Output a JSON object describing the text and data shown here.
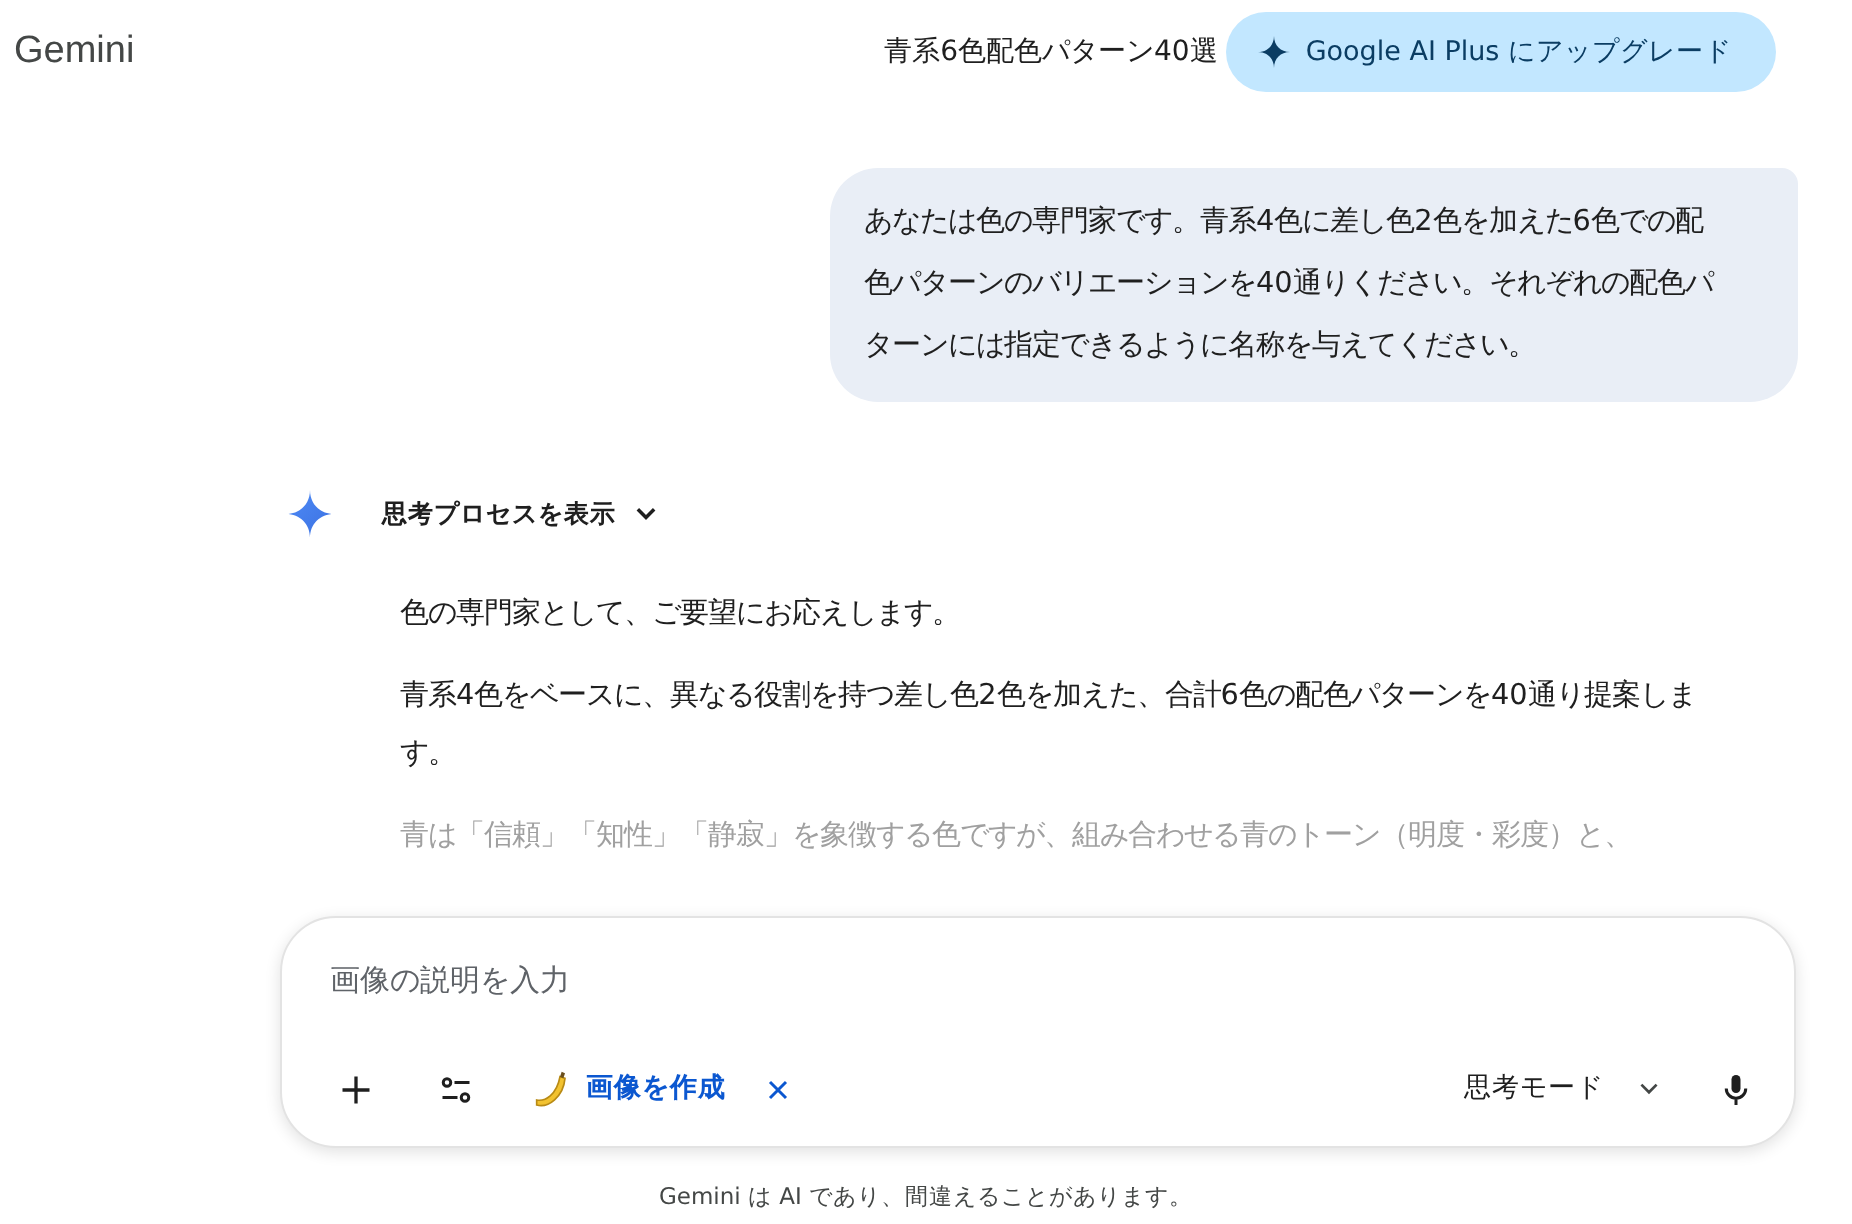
{
  "app_title": "Gemini",
  "conversation_title": "青系6色配色パターン40選",
  "upgrade_button": "Google AI Plus にアップグレード",
  "user_message": "あなたは色の専門家です。青系4色に差し色2色を加えた6色での配色パターンのバリエーションを40通りください。それぞれの配色パターンには指定できるように名称を与えてください。",
  "thinking_toggle": {
    "label": "思考プロセスを表示",
    "expanded": false
  },
  "response_paragraphs": [
    {
      "text": "色の専門家として、ご要望にお応えします。",
      "faded": false
    },
    {
      "text": "青系4色をベースに、異なる役割を持つ差し色2色を加えた、合計6色の配色パターンを40通り提案します。",
      "faded": false
    },
    {
      "text": "青は「信頼」「知性」「静寂」を象徴する色ですが、組み合わせる青のトーン（明度・彩度）と、",
      "faded": true
    }
  ],
  "input": {
    "placeholder": "画像の説明を入力"
  },
  "tool_chip": {
    "label": "画像を作成"
  },
  "mode_selector": "思考モード",
  "disclaimer": "Gemini は AI であり、間違えることがあります。"
}
